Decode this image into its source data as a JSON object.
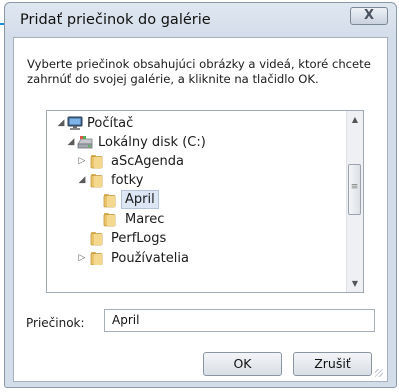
{
  "window": {
    "title": "Pridať priečinok do galérie",
    "close_label": "X"
  },
  "instruction": "Vyberte priečinok obsahujúci obrázky a videá, ktoré chcete zahrnúť do svojej galérie, a kliknite na tlačidlo OK.",
  "tree": {
    "items": [
      {
        "label": "Počítač",
        "expander": "◢",
        "icon": "computer-icon"
      },
      {
        "label": "Lokálny disk (C:)",
        "expander": "◢",
        "icon": "drive-icon"
      },
      {
        "label": "aScAgenda",
        "expander": "▷",
        "icon": "folder-icon"
      },
      {
        "label": "fotky",
        "expander": "◢",
        "icon": "folder-icon"
      },
      {
        "label": "April",
        "expander": "",
        "icon": "folder-icon",
        "selected": true
      },
      {
        "label": "Marec",
        "expander": "",
        "icon": "folder-icon"
      },
      {
        "label": "PerfLogs",
        "expander": "",
        "icon": "folder-icon"
      },
      {
        "label": "Používatelia",
        "expander": "▷",
        "icon": "folder-icon"
      }
    ],
    "scroll_up": "▲",
    "scroll_down": "▼",
    "thumb_grip": "≡"
  },
  "folder_field": {
    "label": "Priečinok:",
    "value": "April"
  },
  "buttons": {
    "ok": "OK",
    "cancel": "Zrušiť"
  },
  "colors": {
    "accent_pointer": "#1a8fd6",
    "selection": "#dce6f4",
    "folder": "#e8c36a"
  }
}
